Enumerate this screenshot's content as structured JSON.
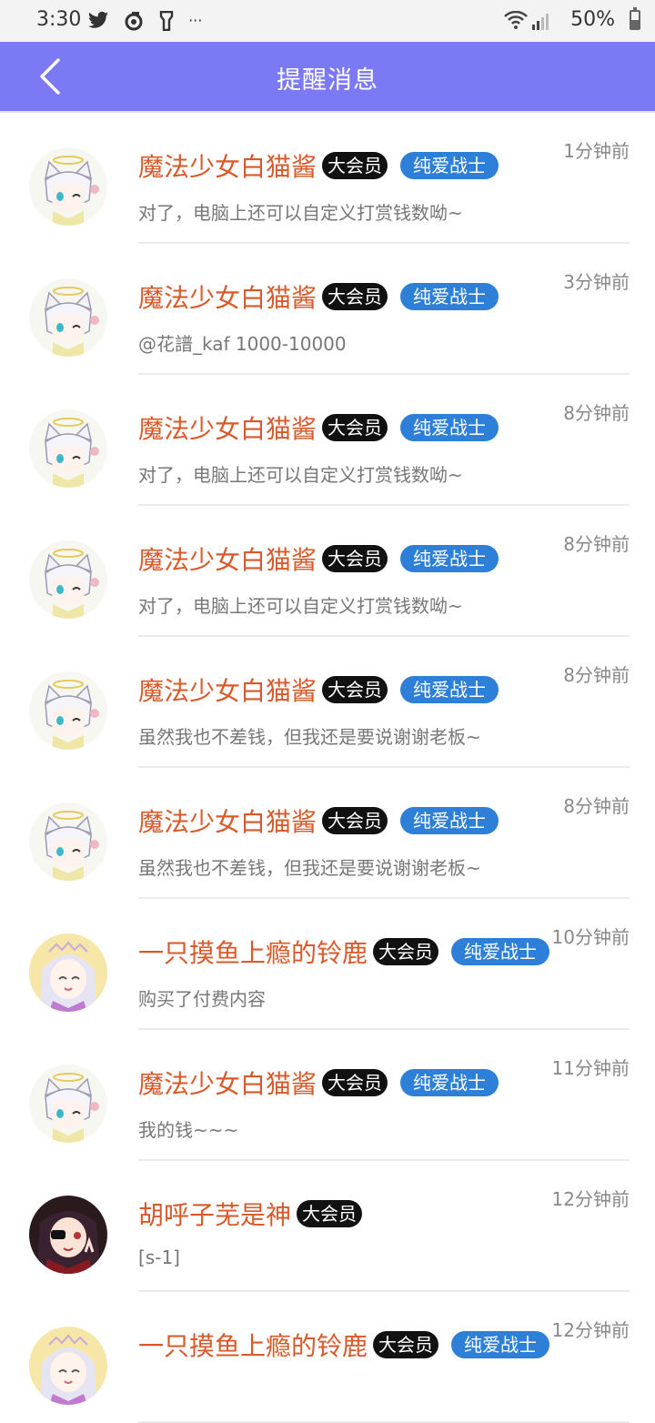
{
  "status_bar": {
    "time": "3:30",
    "battery_text": "50%",
    "battery_level": 0.5,
    "icons": [
      "twitter-icon",
      "sync-icon",
      "flashlight-icon",
      "more-icon",
      "wifi-icon",
      "signal-icon",
      "battery-icon"
    ],
    "more": "···"
  },
  "app_bar": {
    "title": "提醒消息",
    "background": "#7b79f4"
  },
  "colors": {
    "name": "#d85a2a",
    "vip_badge": "#111111",
    "tag_badge": "#2d7fd7",
    "message": "#777777",
    "time": "#888888"
  },
  "notifications": [
    {
      "name": "魔法少女白猫酱",
      "vip": "大会员",
      "tag": "纯爱战士",
      "message": "对了，电脑上还可以自定义打赏钱数呦~",
      "time": "1分钟前",
      "avatar": "cat-girl-avatar"
    },
    {
      "name": "魔法少女白猫酱",
      "vip": "大会员",
      "tag": "纯爱战士",
      "message": "@花譜_kaf 1000-10000",
      "time": "3分钟前",
      "avatar": "cat-girl-avatar"
    },
    {
      "name": "魔法少女白猫酱",
      "vip": "大会员",
      "tag": "纯爱战士",
      "message": "对了，电脑上还可以自定义打赏钱数呦~",
      "time": "8分钟前",
      "avatar": "cat-girl-avatar"
    },
    {
      "name": "魔法少女白猫酱",
      "vip": "大会员",
      "tag": "纯爱战士",
      "message": "对了，电脑上还可以自定义打赏钱数呦~",
      "time": "8分钟前",
      "avatar": "cat-girl-avatar"
    },
    {
      "name": "魔法少女白猫酱",
      "vip": "大会员",
      "tag": "纯爱战士",
      "message": "虽然我也不差钱，但我还是要说谢谢老板~",
      "time": "8分钟前",
      "avatar": "cat-girl-avatar"
    },
    {
      "name": "魔法少女白猫酱",
      "vip": "大会员",
      "tag": "纯爱战士",
      "message": "虽然我也不差钱，但我还是要说谢谢老板~",
      "time": "8分钟前",
      "avatar": "cat-girl-avatar"
    },
    {
      "name": "一只摸鱼上瘾的铃鹿",
      "vip": "大会员",
      "tag": "纯爱战士",
      "message": "购买了付费内容",
      "time": "10分钟前",
      "avatar": "silver-hair-girl-avatar"
    },
    {
      "name": "魔法少女白猫酱",
      "vip": "大会员",
      "tag": "纯爱战士",
      "message": "我的钱~~~",
      "time": "11分钟前",
      "avatar": "cat-girl-avatar"
    },
    {
      "name": "胡呼子芜是神",
      "vip": "大会员",
      "tag": "",
      "message": "[s-1]",
      "time": "12分钟前",
      "avatar": "dark-hair-girl-avatar"
    },
    {
      "name": "一只摸鱼上瘾的铃鹿",
      "vip": "大会员",
      "tag": "纯爱战士",
      "message": "",
      "time": "12分钟前",
      "avatar": "silver-hair-girl-avatar"
    }
  ]
}
